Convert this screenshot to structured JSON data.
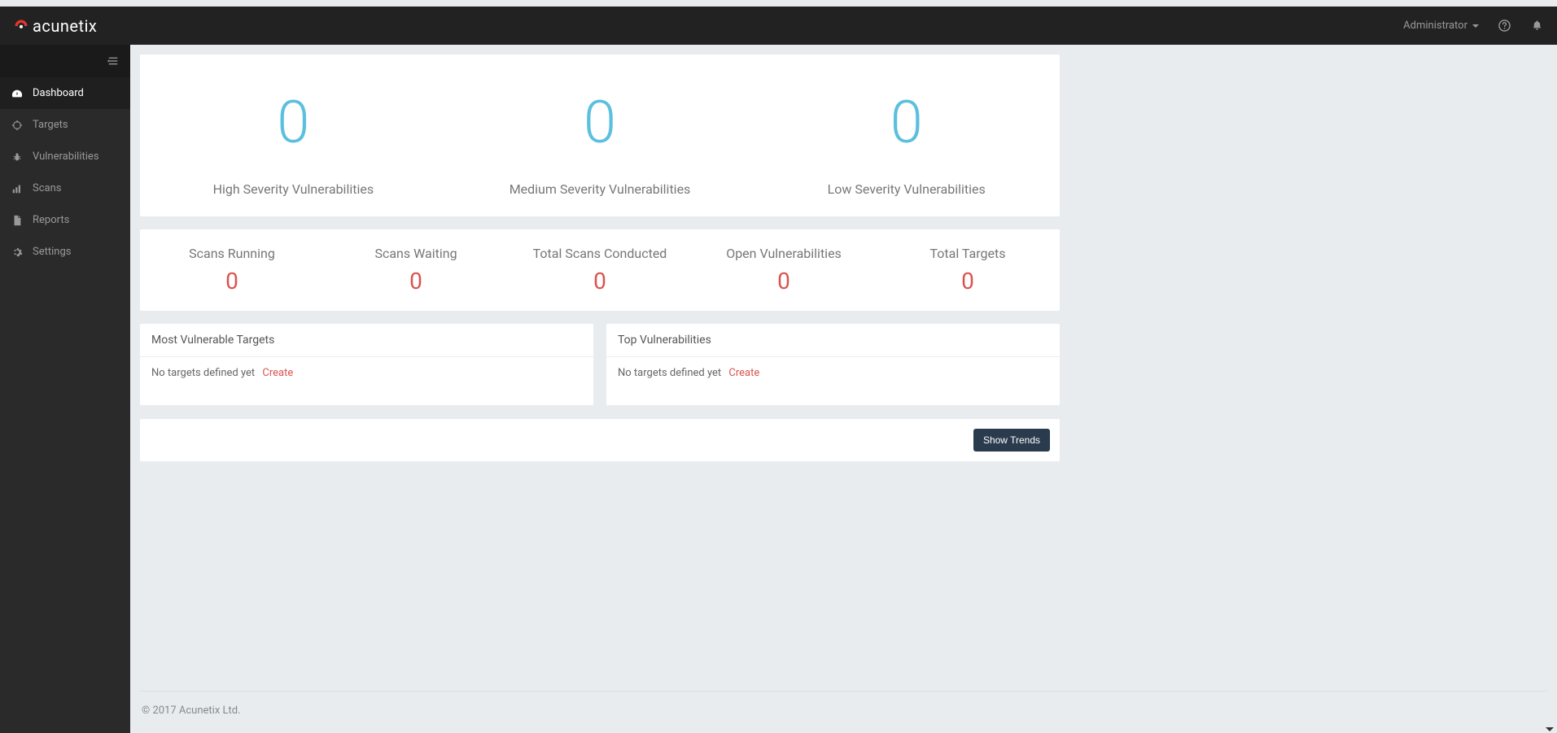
{
  "brand": {
    "name": "acunetix"
  },
  "header": {
    "user_label": "Administrator"
  },
  "sidebar": {
    "items": [
      {
        "label": "Dashboard",
        "icon": "tachometer",
        "active": true
      },
      {
        "label": "Targets",
        "icon": "crosshair",
        "active": false
      },
      {
        "label": "Vulnerabilities",
        "icon": "bug",
        "active": false
      },
      {
        "label": "Scans",
        "icon": "chart",
        "active": false
      },
      {
        "label": "Reports",
        "icon": "file",
        "active": false
      },
      {
        "label": "Settings",
        "icon": "gear",
        "active": false
      }
    ]
  },
  "dashboard": {
    "severity": [
      {
        "value": "0",
        "label": "High Severity Vulnerabilities"
      },
      {
        "value": "0",
        "label": "Medium Severity Vulnerabilities"
      },
      {
        "value": "0",
        "label": "Low Severity Vulnerabilities"
      }
    ],
    "stats": [
      {
        "label": "Scans Running",
        "value": "0"
      },
      {
        "label": "Scans Waiting",
        "value": "0"
      },
      {
        "label": "Total Scans Conducted",
        "value": "0"
      },
      {
        "label": "Open Vulnerabilities",
        "value": "0"
      },
      {
        "label": "Total Targets",
        "value": "0"
      }
    ],
    "panels": {
      "left": {
        "title": "Most Vulnerable Targets",
        "empty_text": "No targets defined yet",
        "create_label": "Create"
      },
      "right": {
        "title": "Top Vulnerabilities",
        "empty_text": "No targets defined yet",
        "create_label": "Create"
      }
    },
    "trends_button": "Show Trends"
  },
  "footer": {
    "copyright": "© 2017 Acunetix Ltd."
  }
}
